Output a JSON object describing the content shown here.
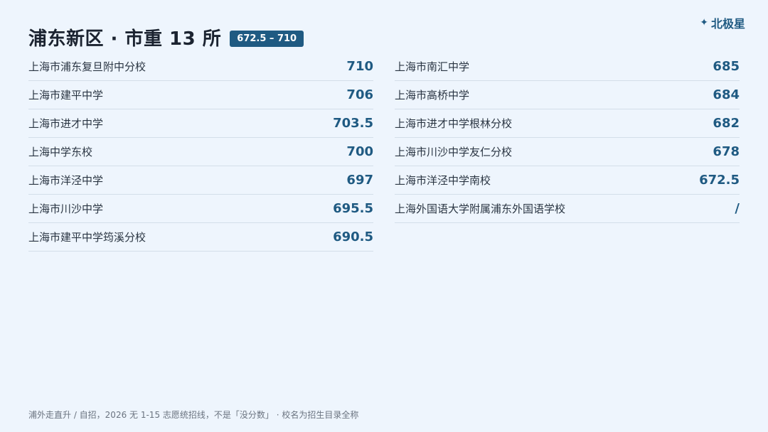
{
  "brand": {
    "icon": "✦",
    "name": "北极星"
  },
  "header": {
    "title": "浦东新区 · 市重 13 所",
    "range": "672.5 – 710"
  },
  "left_column": [
    {
      "school": "上海市浦东复旦附中分校",
      "score": "710"
    },
    {
      "school": "上海市建平中学",
      "score": "706"
    },
    {
      "school": "上海市进才中学",
      "score": "703.5"
    },
    {
      "school": "上海中学东校",
      "score": "700"
    },
    {
      "school": "上海市洋泾中学",
      "score": "697"
    },
    {
      "school": "上海市川沙中学",
      "score": "695.5"
    },
    {
      "school": "上海市建平中学筠溪分校",
      "score": "690.5"
    }
  ],
  "right_column": [
    {
      "school": "上海市南汇中学",
      "score": "685"
    },
    {
      "school": "上海市高桥中学",
      "score": "684"
    },
    {
      "school": "上海市进才中学根林分校",
      "score": "682"
    },
    {
      "school": "上海市川沙中学友仁分校",
      "score": "678"
    },
    {
      "school": "上海市洋泾中学南校",
      "score": "672.5"
    },
    {
      "school": "上海外国语大学附属浦东外国语学校",
      "score": "/"
    }
  ],
  "footer": {
    "note": "浦外走直升 / 自招，2026 无 1-15 志愿统招线，不是「没分数」 · 校名为招生目录全称"
  },
  "colors": {
    "background": "#eef5fd",
    "accent": "#1f5a82",
    "divider": "#d3dee9"
  }
}
